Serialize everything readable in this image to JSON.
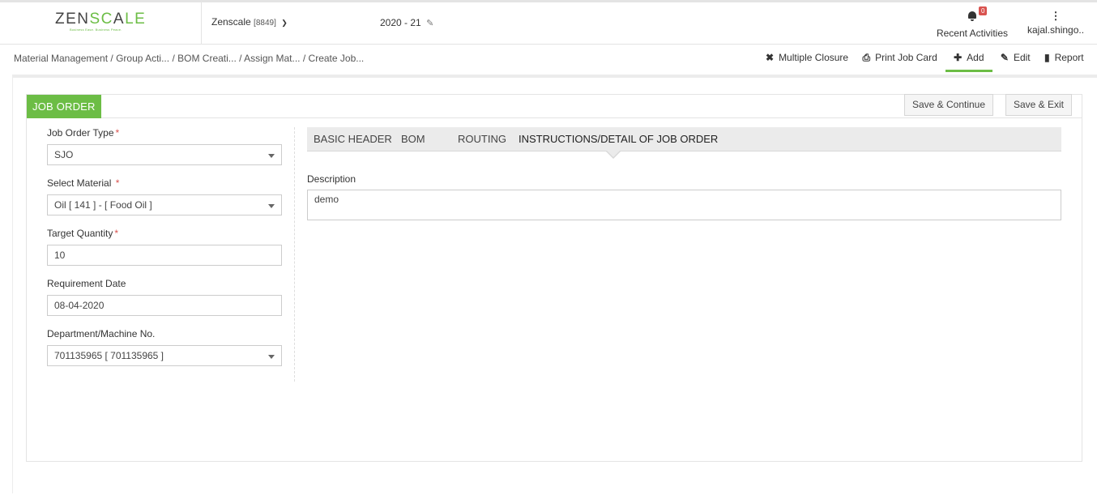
{
  "header": {
    "logo_prefix": "ZEN",
    "logo_accent": "SC",
    "logo_mid": "A",
    "logo_suffix": "LE",
    "logo_tagline": "Business Ease. Business Peace.",
    "company_name": "Zenscale",
    "company_code": "[8849]",
    "fiscal_year": "2020 - 21",
    "notification_count": "0",
    "notification_label": "Recent Activities",
    "user_label": "kajal.shingo.."
  },
  "breadcrumb": {
    "items": [
      "Material Management",
      "/ Group Acti...",
      "/ BOM Creati...",
      "/ Assign Mat...",
      "/ Create Job..."
    ]
  },
  "toolbar": {
    "multiple_closure": "Multiple Closure",
    "print_job_card": "Print Job Card",
    "add": "Add",
    "edit": "Edit",
    "report": "Report"
  },
  "form": {
    "tab_title": "JOB ORDER",
    "save_continue": "Save & Continue",
    "save_exit": "Save & Exit",
    "fields": {
      "job_order_type": {
        "label": "Job Order Type",
        "value": "SJO"
      },
      "select_material": {
        "label": "Select Material",
        "value": "Oil [ 141 ] - [ Food Oil ]"
      },
      "target_quantity": {
        "label": "Target Quantity",
        "value": "10"
      },
      "requirement_date": {
        "label": "Requirement Date",
        "value": "08-04-2020"
      },
      "department": {
        "label": "Department/Machine No.",
        "value": "701135965 [ 701135965 ]"
      }
    },
    "required_mark": "*",
    "tabs": {
      "basic_header": "BASIC HEADER",
      "bom": "BOM",
      "routing": "ROUTING",
      "instructions": "INSTRUCTIONS/DETAIL OF JOB ORDER"
    },
    "active_tab": "instructions",
    "description_label": "Description",
    "description_value": "demo"
  },
  "colors": {
    "accent_green": "#6cbd45",
    "badge_red": "#d9534f"
  }
}
